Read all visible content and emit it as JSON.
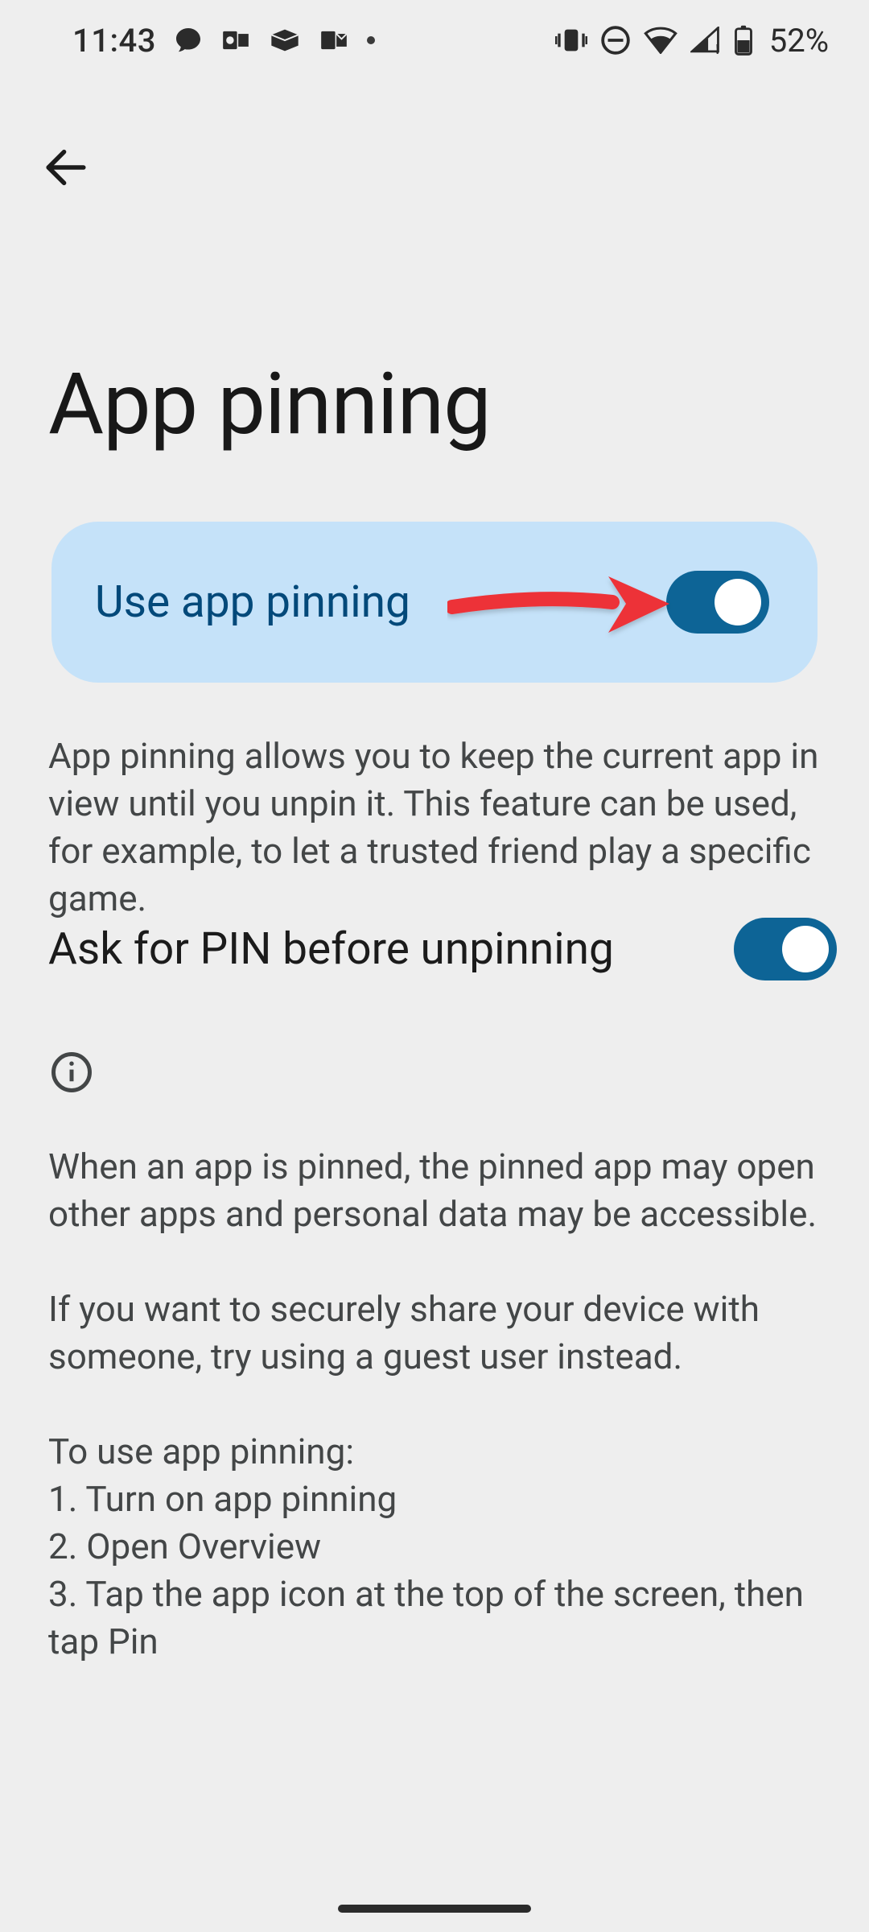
{
  "status": {
    "time": "11:43",
    "battery": "52%"
  },
  "page": {
    "title": "App pinning"
  },
  "primary_toggle": {
    "label": "Use app pinning",
    "state": "on"
  },
  "description_main": "App pinning allows you to keep the current app in view until you unpin it. This feature can be used, for example, to let a trusted friend play a specific game.",
  "pin_setting": {
    "label": "Ask for PIN before unpinning",
    "state": "on"
  },
  "info_block": "When an app is pinned, the pinned app may open other apps and personal data may be accessible.\n\nIf you want to securely share your device with someone, try using a guest user instead.\n\nTo use app pinning:\n1. Turn on app pinning\n2. Open Overview\n3. Tap the app icon at the top of the screen, then tap Pin",
  "icons": {
    "back": "arrow-left-icon",
    "info": "info-circle-icon",
    "status_left": [
      "chat-bubble-icon",
      "outlook-icon",
      "box-icon",
      "outlook-mail-icon",
      "more-dot-icon"
    ],
    "status_right": [
      "vibrate-icon",
      "dnd-icon",
      "wifi-icon",
      "signal-icon",
      "battery-icon"
    ]
  },
  "colors": {
    "card_bg": "#c5e2f9",
    "card_text": "#03497a",
    "toggle_on": "#0d6496",
    "annotation_arrow": "#ed3237"
  }
}
